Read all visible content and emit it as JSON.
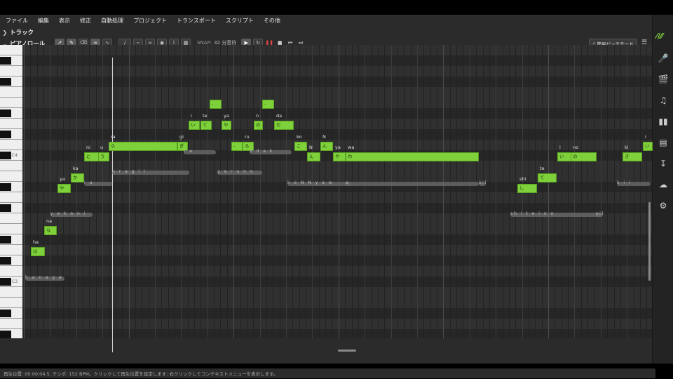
{
  "menu": [
    "ファイル",
    "編集",
    "表示",
    "修正",
    "自動処理",
    "プロジェクト",
    "トランスポート",
    "スクリプト",
    "その他"
  ],
  "track_label": "トラック",
  "piano_roll_label": "ピアノロール",
  "snap": {
    "label": "SNAP:",
    "value": "32 分音符"
  },
  "pitch_mode_button": "簡易ピッチモード",
  "ruler_labels": [
    "91",
    "92",
    "93",
    "94",
    "95",
    "96"
  ],
  "key_labels": [
    "C4",
    "C3"
  ],
  "notes": [
    {
      "text": "は",
      "lyric": "ha"
    },
    {
      "text": "な",
      "lyric": "na"
    },
    {
      "text": "や",
      "lyric": "ya"
    },
    {
      "text": "か",
      "lyric": "ka"
    },
    {
      "text": "に",
      "lyric": "ni"
    },
    {
      "text": "う",
      "lyric": "u"
    },
    {
      "text": "ら",
      "lyric": "ra"
    },
    {
      "text": "ぎ",
      "lyric": "gi"
    },
    {
      "text": "い",
      "lyric": "i"
    },
    {
      "text": "て",
      "lyric": "te"
    },
    {
      "text": "-",
      "lyric": ""
    },
    {
      "text": "や",
      "lyric": "ya"
    },
    {
      "text": "-",
      "lyric": ""
    },
    {
      "text": "る",
      "lyric": "ru"
    },
    {
      "text": "の",
      "lyric": "n"
    },
    {
      "text": "-",
      "lyric": ""
    },
    {
      "text": "だ",
      "lyric": "da"
    },
    {
      "text": "こ",
      "lyric": "ko"
    },
    {
      "text": "ん",
      "lyric": "N"
    },
    {
      "text": "ん",
      "lyric": "N"
    },
    {
      "text": "や",
      "lyric": "ya"
    },
    {
      "text": "わ",
      "lyric": "wa"
    },
    {
      "text": "し",
      "lyric": "shi"
    },
    {
      "text": "て",
      "lyric": "te"
    },
    {
      "text": "い",
      "lyric": "i"
    },
    {
      "text": "の",
      "lyric": "no"
    },
    {
      "text": "き",
      "lyric": "ki"
    },
    {
      "text": "い",
      "lyric": "i"
    }
  ],
  "phoneme_strips": [
    "h a n a y a",
    "y a k a n i",
    "i u",
    "u r a g i i",
    "t e",
    "y a r u n o",
    "o d a k",
    "k o N N y a w",
    "a",
    "sil",
    "sh i t e i n o",
    "sil",
    "k i i"
  ],
  "status_text": "再生位置: 00:00:04.5, テンポ: 152 BPM。クリックして再生位置を設定します; 右クリックしてコンテキストメニューを表示します。",
  "colors": {
    "note": "#7fd13b",
    "background": "#2b2b2b"
  }
}
